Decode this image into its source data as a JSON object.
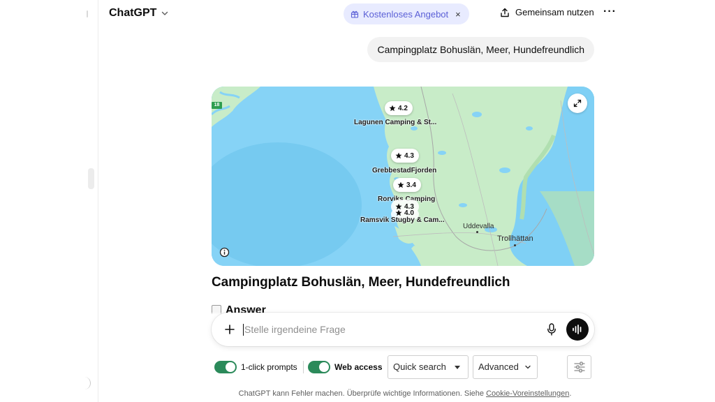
{
  "header": {
    "app_title": "ChatGPT",
    "promo_label": "Kostenloses Angebot",
    "promo_close": "×",
    "share_label": "Gemeinsam nutzen",
    "more_label": "···"
  },
  "conversation": {
    "user_message": "Campingplatz Bohuslän, Meer, Hundefreundlich"
  },
  "map": {
    "road_number": "18",
    "places": [
      {
        "rating": "4.2",
        "name": "Lagunen Camping & St..."
      },
      {
        "rating": "4.3",
        "name": "GrebbestadFjorden"
      },
      {
        "rating": "3.4",
        "name": "Rorviks Camping"
      },
      {
        "rating": "4.3",
        "name": ""
      },
      {
        "rating": "4.0",
        "name": "Ramsvik Stugby & Cam..."
      }
    ],
    "towns": [
      "Uddevalla",
      "Trollhättan"
    ],
    "water_color": "#7fd0f5",
    "land_color": "#c8ecc8"
  },
  "answer": {
    "title": "Campingplatz Bohuslän, Meer, Hundefreundlich",
    "heading": "Answer"
  },
  "composer": {
    "placeholder": "Stelle irgendeine Frage"
  },
  "controls": {
    "one_click_label": "1-click prompts",
    "one_click_on": true,
    "web_access_label": "Web access",
    "web_access_on": true,
    "search_mode": "Quick search",
    "depth_mode": "Advanced",
    "toggle_color": "#2b8a5a"
  },
  "footer": {
    "disclaimer": "ChatGPT kann Fehler machen. Überprüfe wichtige Informationen. Siehe",
    "link": "Cookie-Voreinstellungen",
    "end": "."
  }
}
